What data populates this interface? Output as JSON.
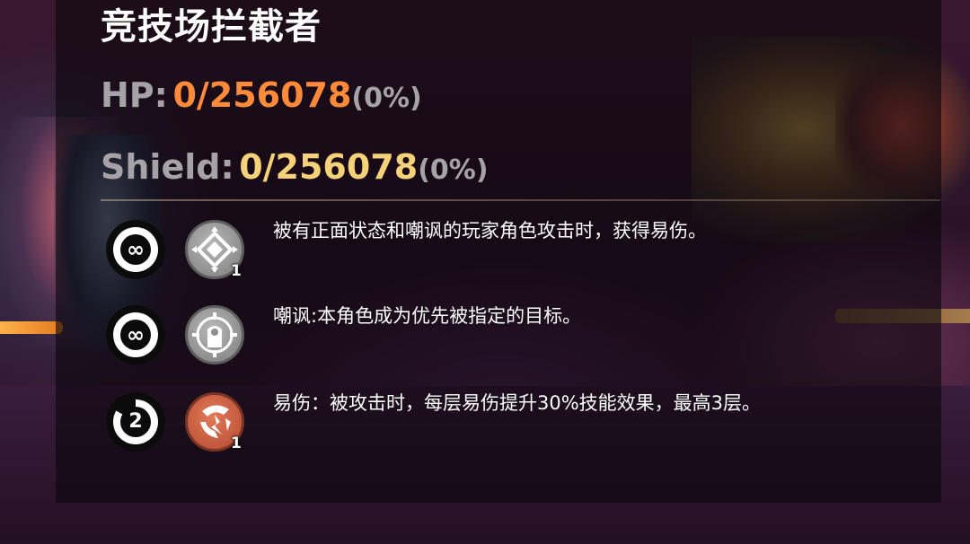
{
  "enemy": {
    "name": "竞技场拦截者",
    "hp": {
      "label": "HP:",
      "value": "0/256078",
      "percent": "(0%)"
    },
    "shield": {
      "label": "Shield:",
      "value": "0/256078",
      "percent": "(0%)"
    }
  },
  "effects": [
    {
      "duration_text": "∞",
      "icon": "diamond-target-icon",
      "stacks": "1",
      "description": "被有正面状态和嘲讽的玩家角色攻击时，获得易伤。"
    },
    {
      "duration_text": "∞",
      "icon": "taunt-shield-icon",
      "stacks": "",
      "description": "嘲讽:本角色成为优先被指定的目标。"
    },
    {
      "duration_text": "2",
      "icon": "vulnerable-crack-icon",
      "stacks": "1",
      "description": "易伤：被攻击时，每层易伤提升30%技能效果，最高3层。"
    }
  ],
  "colors": {
    "hp_value": "#ff8a3a",
    "shield_value": "#f5d27a",
    "label_grey": "#a6a2a8",
    "badge_grey": "#9a9a9a",
    "badge_red": "#c3583c"
  }
}
